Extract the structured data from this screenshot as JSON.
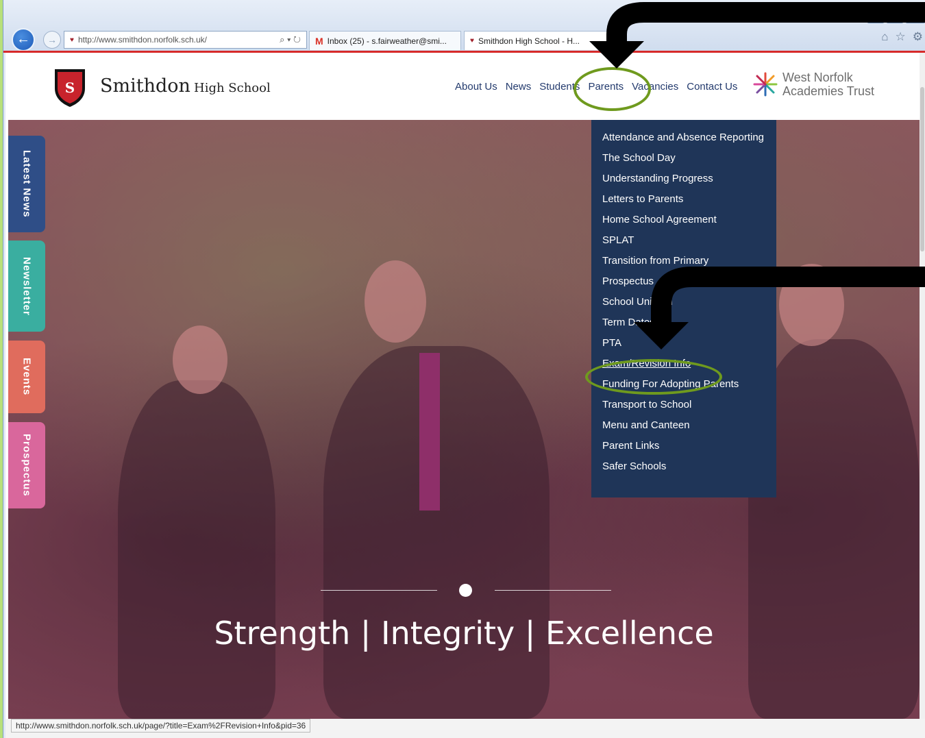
{
  "browser": {
    "address_url": "http://www.smithdon.norfolk.sch.uk/",
    "tabs": [
      {
        "label": "Inbox (25) - s.fairweather@smi..."
      },
      {
        "label": "Smithdon High School - H..."
      }
    ],
    "window_controls": [
      "–",
      "▢",
      "✕"
    ],
    "status_url": "http://www.smithdon.norfolk.sch.uk/page/?title=Exam%2FRevision+Info&pid=36"
  },
  "site": {
    "name_big": "Smithdon",
    "name_small": "High School",
    "nav": [
      "About Us",
      "News",
      "Students",
      "Parents",
      "Vacancies",
      "Contact Us"
    ],
    "trust": {
      "line1": "West Norfolk",
      "line2": "Academies Trust"
    }
  },
  "side_tabs": [
    "Latest News",
    "Newsletter",
    "Events",
    "Prospectus"
  ],
  "parents_menu": [
    "Attendance and Absence Reporting",
    "The School Day",
    "Understanding Progress",
    "Letters to Parents",
    "Home School Agreement",
    "SPLAT",
    "Transition from Primary",
    "Prospectus",
    "School Uniform",
    "Term Dates",
    "PTA",
    "Exam/Revision Info",
    "Funding For Adopting Parents",
    "Transport to School",
    "Menu and Canteen",
    "Parent Links",
    "Safer Schools"
  ],
  "hero": {
    "tagline": "Strength | Integrity | Excellence"
  },
  "colors": {
    "annotation_green": "#6f9a1e",
    "nav_blue": "#233a6d",
    "dropdown_bg": "#1f3558",
    "brand_red": "#d72a2a"
  }
}
